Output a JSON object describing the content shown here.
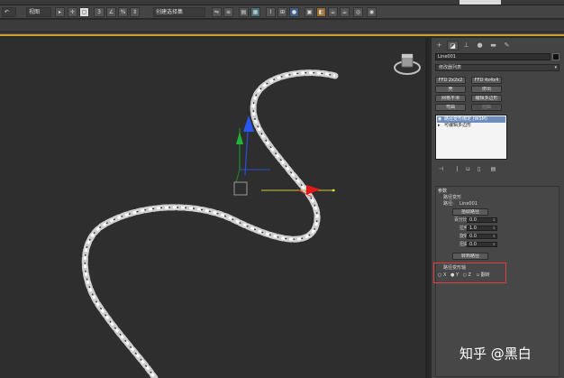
{
  "toolbar": {
    "view_dropdown": "视图",
    "selection_set_dropdown": "创建选择集",
    "snap_label": "3"
  },
  "panel": {
    "object_name": "Line001",
    "modifier_list": "修改器列表",
    "buttons": [
      "FFD 2x2x2",
      "FFD 4x4x4",
      "壳",
      "挤出",
      "网格平滑",
      "编辑多边形",
      "弯曲",
      "扭曲"
    ],
    "stack_items": [
      "路径变形绑定 (WSM)",
      "可编辑多边形"
    ],
    "rollout": {
      "title": "参数",
      "path_deform": "路径变形",
      "path_label": "路径:",
      "path_value": "Line001",
      "pick_path": "拾取路径",
      "percent_label": "百分比",
      "percent_value": "0.0",
      "stretch_label": "拉伸",
      "stretch_value": "1.0",
      "rotation_label": "旋转",
      "rotation_value": "0.0",
      "twist_label": "扭曲",
      "twist_value": "0.0",
      "move_to_path": "转到路径",
      "axis_title": "路径变形轴",
      "axis_x": "X",
      "axis_y": "Y",
      "axis_z": "Z",
      "flip": "翻转"
    }
  },
  "watermark": "知乎 @黑白",
  "colors": {
    "viewport_bg": "#2e2e2e",
    "chain": "#f0f0f0",
    "highlight_box": "#e23d3d",
    "selected_modifier": "#6e8ebd"
  }
}
